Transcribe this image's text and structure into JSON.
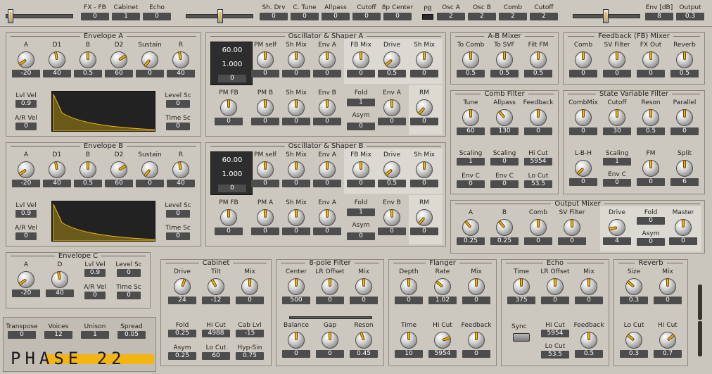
{
  "top": {
    "groups": [
      {
        "label": "FX - FB",
        "value": "0"
      },
      {
        "label": "Cabinet",
        "value": "1"
      },
      {
        "label": "Echo",
        "value": "0"
      },
      {
        "label": "Sh. Drv",
        "value": "0"
      },
      {
        "label": "C. Tune",
        "value": "0"
      },
      {
        "label": "Allpass",
        "value": "0"
      },
      {
        "label": "Cutoff",
        "value": "0"
      },
      {
        "label": "8p Center",
        "value": "0"
      },
      {
        "label": "Osc A",
        "value": "2"
      },
      {
        "label": "Osc B",
        "value": "2"
      },
      {
        "label": "Comb",
        "value": "2"
      },
      {
        "label": "Cutoff",
        "value": "2"
      },
      {
        "label": "Env [dB]",
        "value": "8"
      },
      {
        "label": "Output",
        "value": "0.3"
      }
    ],
    "pb_label": "PB"
  },
  "env_a": {
    "title": "Envelope A",
    "knobs": [
      {
        "label": "A",
        "value": "-20"
      },
      {
        "label": "D1",
        "value": "40"
      },
      {
        "label": "B",
        "value": "0.5"
      },
      {
        "label": "D2",
        "value": "60"
      },
      {
        "label": "Sustain",
        "value": "0"
      },
      {
        "label": "R",
        "value": "40"
      }
    ],
    "lvl_vel": {
      "label": "Lvl Vel",
      "value": "0.9"
    },
    "ar_vel": {
      "label": "A/R Vel",
      "value": "0"
    },
    "level_sc": {
      "label": "Level Sc",
      "value": "0"
    },
    "time_sc": {
      "label": "Time Sc",
      "value": "0"
    }
  },
  "env_b": {
    "title": "Envelope B",
    "knobs": [
      {
        "label": "A",
        "value": "-20"
      },
      {
        "label": "D1",
        "value": "40"
      },
      {
        "label": "B",
        "value": "0.5"
      },
      {
        "label": "D2",
        "value": "60"
      },
      {
        "label": "Sustain",
        "value": "0"
      },
      {
        "label": "R",
        "value": "40"
      }
    ],
    "lvl_vel": {
      "label": "Lvl Vel",
      "value": "0.9"
    },
    "ar_vel": {
      "label": "A/R Vel",
      "value": "0"
    },
    "level_sc": {
      "label": "Level Sc",
      "value": "0"
    },
    "time_sc": {
      "label": "Time Sc",
      "value": "0"
    }
  },
  "env_c": {
    "title": "Envelope C",
    "a": {
      "label": "A",
      "value": "-20"
    },
    "d": {
      "label": "D",
      "value": "40"
    },
    "lvl_vel": {
      "label": "Lvl Vel",
      "value": "0.9"
    },
    "ar_vel": {
      "label": "A/R Vel",
      "value": "0"
    },
    "level_sc": {
      "label": "Level Sc",
      "value": "0"
    },
    "time_sc": {
      "label": "Time Sc",
      "value": "0"
    }
  },
  "osc_a": {
    "title": "Oscillator & Shaper A",
    "disp1": "60.00",
    "disp2": "1.000",
    "disp3": "0",
    "row1": [
      {
        "label": "PM self",
        "value": "0"
      },
      {
        "label": "Sh Mix",
        "value": "0"
      },
      {
        "label": "Env A",
        "value": "0"
      },
      {
        "label": "FB Mix",
        "value": "0"
      },
      {
        "label": "Drive",
        "value": "0.5"
      },
      {
        "label": "Sh Mix",
        "value": "0"
      }
    ],
    "row2": [
      {
        "label": "PM FB",
        "value": "0"
      },
      {
        "label": "PM B",
        "value": "0"
      },
      {
        "label": "Sh Mix",
        "value": "0"
      },
      {
        "label": "Env B",
        "value": "0"
      },
      {
        "label": "Env A",
        "value": "0"
      },
      {
        "label": "RM",
        "value": "0"
      }
    ],
    "fold": {
      "label": "Fold",
      "value": "1"
    },
    "asym": {
      "label": "Asym",
      "value": "0"
    }
  },
  "osc_b": {
    "title": "Oscillator & Shaper B",
    "disp1": "60.00",
    "disp2": "1.000",
    "disp3": "0",
    "row1": [
      {
        "label": "PM self",
        "value": "0"
      },
      {
        "label": "Sh Mix",
        "value": "0"
      },
      {
        "label": "Env A",
        "value": "0"
      },
      {
        "label": "FB Mix",
        "value": "0"
      },
      {
        "label": "Drive",
        "value": "0.5"
      },
      {
        "label": "Sh Mix",
        "value": "0"
      }
    ],
    "row2": [
      {
        "label": "PM FB",
        "value": "0"
      },
      {
        "label": "PM A",
        "value": "0"
      },
      {
        "label": "Sh Mix",
        "value": "0"
      },
      {
        "label": "Env A",
        "value": "0"
      },
      {
        "label": "Env B",
        "value": "0"
      },
      {
        "label": "RM",
        "value": "0"
      }
    ],
    "fold": {
      "label": "Fold",
      "value": "1"
    },
    "asym": {
      "label": "Asym",
      "value": "0"
    }
  },
  "ab_mixer": {
    "title": "A-B Mixer",
    "knobs": [
      {
        "label": "To Comb",
        "value": "0.5"
      },
      {
        "label": "To SVF",
        "value": "0.5"
      },
      {
        "label": "Filt FM",
        "value": "0.5"
      }
    ]
  },
  "fb_mixer": {
    "title": "Feedback (FB) Mixer",
    "knobs": [
      {
        "label": "Comb",
        "value": "0"
      },
      {
        "label": "SV Filter",
        "value": "0"
      },
      {
        "label": "FX Out",
        "value": "0"
      },
      {
        "label": "Reverb",
        "value": "0.5"
      }
    ]
  },
  "comb": {
    "title": "Comb Filter",
    "knobs": [
      {
        "label": "Tune",
        "value": "60"
      },
      {
        "label": "Allpass",
        "value": "130"
      },
      {
        "label": "Feedback",
        "value": "0"
      }
    ],
    "small": [
      {
        "label": "Scaling",
        "value": "1"
      },
      {
        "label": "Scaling",
        "value": "0"
      },
      {
        "label": "Hi Cut",
        "value": "5954"
      },
      {
        "label": "Env C",
        "value": "0"
      },
      {
        "label": "Env C",
        "value": "0"
      },
      {
        "label": "Lo Cut",
        "value": "53.5"
      }
    ]
  },
  "svf": {
    "title": "State Variable Filter",
    "knobs": [
      {
        "label": "CombMix",
        "value": "0"
      },
      {
        "label": "Cutoff",
        "value": "30"
      },
      {
        "label": "Reson",
        "value": "0.5"
      },
      {
        "label": "Parallel",
        "value": "0"
      }
    ],
    "lbh": {
      "label": "L-B-H",
      "value": "0"
    },
    "scaling": {
      "label": "Scaling",
      "value": "1"
    },
    "envc": {
      "label": "Env C",
      "value": "0"
    },
    "fm": {
      "label": "FM",
      "value": "0"
    },
    "split": {
      "label": "Split",
      "value": "6"
    }
  },
  "out_mixer": {
    "title": "Output Mixer",
    "knobs": [
      {
        "label": "A",
        "value": "0.25"
      },
      {
        "label": "B",
        "value": "0.25"
      },
      {
        "label": "Comb",
        "value": "0"
      },
      {
        "label": "SV Filter",
        "value": "0"
      }
    ],
    "drive": {
      "label": "Drive",
      "value": "4"
    },
    "fold": {
      "label": "Fold",
      "value": "0"
    },
    "asym": {
      "label": "Asym",
      "value": "0"
    },
    "master": {
      "label": "Master",
      "value": "0"
    }
  },
  "voice": {
    "items": [
      {
        "label": "Transpose",
        "value": "0"
      },
      {
        "label": "Voices",
        "value": "12"
      },
      {
        "label": "Unison",
        "value": "1"
      },
      {
        "label": "Spread",
        "value": "0.05"
      }
    ],
    "brand": "PHASE 22"
  },
  "cabinet": {
    "title": "Cabinet",
    "knobs": [
      {
        "label": "Drive",
        "value": "24"
      },
      {
        "label": "Tilt",
        "value": "-12"
      },
      {
        "label": "Mix",
        "value": "0"
      }
    ],
    "small": [
      {
        "label": "Fold",
        "value": "0.25"
      },
      {
        "label": "Hi Cut",
        "value": "4988"
      },
      {
        "label": "Cab Lvl",
        "value": "-15"
      },
      {
        "label": "Asym",
        "value": "0.25"
      },
      {
        "label": "Lo Cut",
        "value": "60"
      },
      {
        "label": "Hyp-Sin",
        "value": "0.75"
      }
    ]
  },
  "pole8": {
    "title": "8-pole Filter",
    "knobs": [
      {
        "label": "Center",
        "value": "500"
      },
      {
        "label": "LR Offset",
        "value": "0"
      },
      {
        "label": "Mix",
        "value": "0"
      },
      {
        "label": "Balance",
        "value": "0"
      },
      {
        "label": "Gap",
        "value": "0"
      },
      {
        "label": "Reson",
        "value": "0.45"
      }
    ]
  },
  "flanger": {
    "title": "Flanger",
    "knobs": [
      {
        "label": "Depth",
        "value": "0"
      },
      {
        "label": "Rate",
        "value": "1.02"
      },
      {
        "label": "Mix",
        "value": "0"
      },
      {
        "label": "Time",
        "value": "10"
      },
      {
        "label": "Hi Cut",
        "value": "5954"
      },
      {
        "label": "Feedback",
        "value": "0"
      }
    ]
  },
  "echo": {
    "title": "Echo",
    "knobs": [
      {
        "label": "Time",
        "value": "375"
      },
      {
        "label": "LR Offset",
        "value": "0"
      },
      {
        "label": "Mix",
        "value": "0"
      },
      {
        "label": "Feedback",
        "value": "0.5"
      }
    ],
    "sync_label": "Sync",
    "hicut": {
      "label": "Hi Cut",
      "value": "5954"
    },
    "locut": {
      "label": "Lo Cut",
      "value": "53.5"
    }
  },
  "reverb": {
    "title": "Reverb",
    "knobs": [
      {
        "label": "Size",
        "value": "0.3"
      },
      {
        "label": "Mix",
        "value": "0"
      },
      {
        "label": "Lo Cut",
        "value": "0.3"
      },
      {
        "label": "Hi Cut",
        "value": "0.7"
      }
    ]
  }
}
